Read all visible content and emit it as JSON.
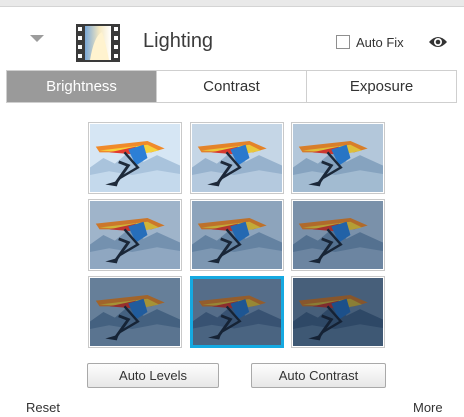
{
  "header": {
    "title": "Lighting",
    "collapse_icon": "chevron-down-icon",
    "panel_icon": "lighting-filmstrip-icon",
    "auto_fix_label": "Auto Fix",
    "auto_fix_checked": false,
    "preview_icon": "eye-icon"
  },
  "tabs": [
    {
      "label": "Brightness",
      "active": true
    },
    {
      "label": "Contrast",
      "active": false
    },
    {
      "label": "Exposure",
      "active": false
    }
  ],
  "thumbnails": {
    "count": 9,
    "selected_index": 7,
    "subject": "hang-glider"
  },
  "buttons": {
    "auto_levels": "Auto Levels",
    "auto_contrast": "Auto Contrast"
  },
  "footer": {
    "reset": "Reset",
    "more": "More"
  },
  "colors": {
    "active_tab": "#9a9a9a",
    "selection": "#15a9e1"
  }
}
